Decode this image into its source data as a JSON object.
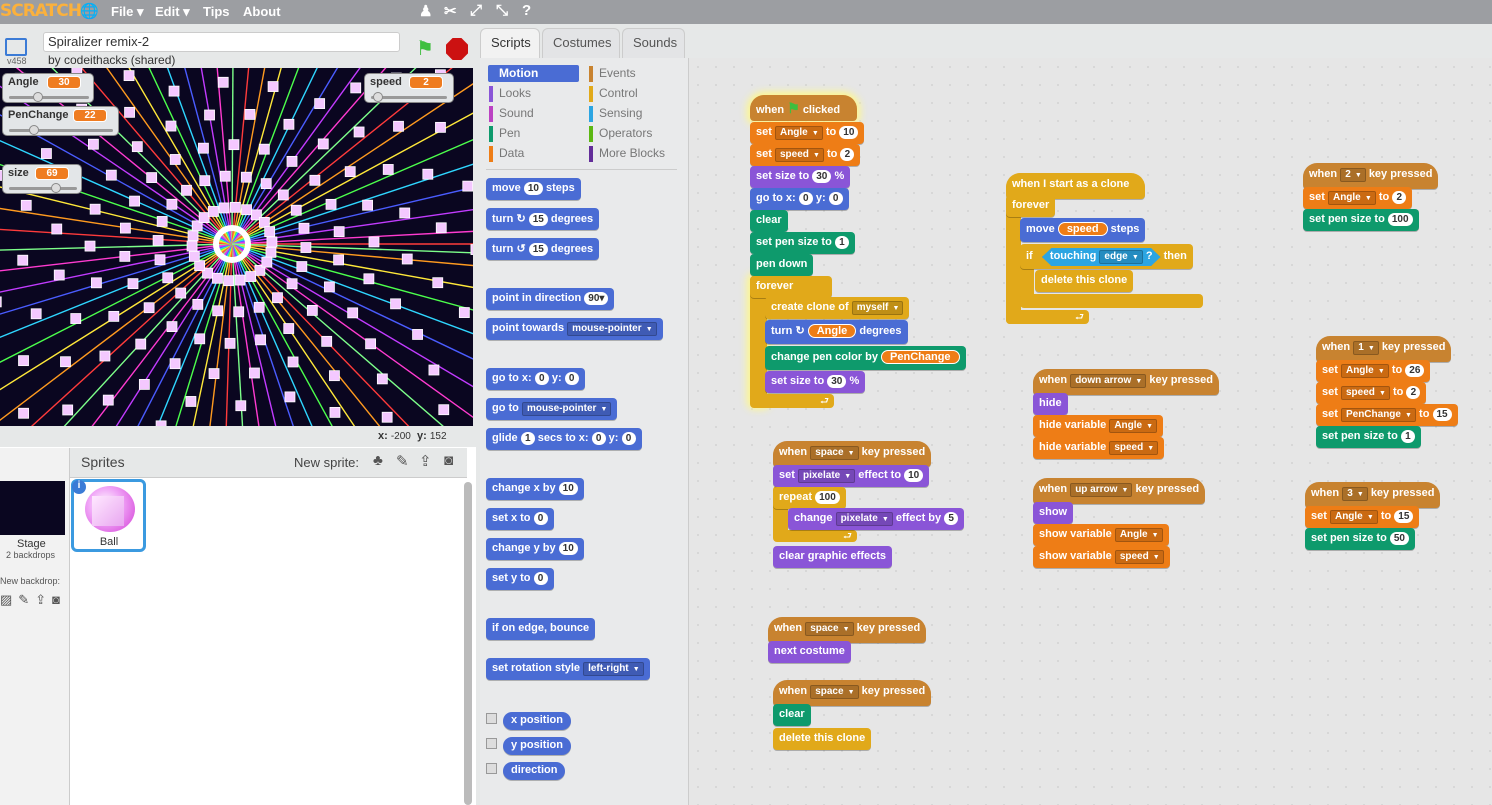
{
  "menu": {
    "logo": "SCRATCH",
    "file": "File ▾",
    "edit": "Edit ▾",
    "tips": "Tips",
    "about": "About"
  },
  "project": {
    "title": "Spiralizer remix-2",
    "by": "by codeithacks (shared)",
    "version": "v458"
  },
  "monitors": {
    "angle_label": "Angle",
    "angle": "30",
    "speed_label": "speed",
    "speed": "2",
    "penchange_label": "PenChange",
    "penchange": "22",
    "size_label": "size",
    "size": "69"
  },
  "coords": {
    "x_label": "x:",
    "x": "-200",
    "y_label": "y:",
    "y": "152"
  },
  "sprites": {
    "header": "Sprites",
    "new_sprite": "New sprite:",
    "stage_label": "Stage",
    "backdrops": "2 backdrops",
    "new_backdrop": "New backdrop:",
    "ball": "Ball"
  },
  "tabs": {
    "scripts": "Scripts",
    "costumes": "Costumes",
    "sounds": "Sounds"
  },
  "categories": {
    "motion": "Motion",
    "looks": "Looks",
    "sound": "Sound",
    "pen": "Pen",
    "data": "Data",
    "events": "Events",
    "control": "Control",
    "sensing": "Sensing",
    "operators": "Operators",
    "more": "More Blocks"
  },
  "palette": {
    "move": "move",
    "move_n": "10",
    "steps": "steps",
    "turn": "turn ↻",
    "turn_n": "15",
    "degrees": "degrees",
    "turnl": "turn ↺",
    "turnl_n": "15",
    "point_dir": "point in direction",
    "point_dir_v": "90▾",
    "point_towards": "point towards",
    "mouse": "mouse-pointer",
    "goto_xy": "go to x:",
    "zero": "0",
    "y": "y:",
    "goto": "go to",
    "glide": "glide",
    "glide_n": "1",
    "secs_to_x": "secs to x:",
    "change_x": "change x by",
    "ten": "10",
    "set_x": "set x to",
    "change_y": "change y by",
    "set_y": "set y to",
    "bounce": "if on edge, bounce",
    "rot_style": "set rotation style",
    "lr": "left-right",
    "xpos": "x position",
    "ypos": "y position",
    "direction": "direction"
  },
  "s1": {
    "when": "when",
    "clicked": "clicked",
    "set": "set",
    "angle": "Angle",
    "to": "to",
    "v10": "10",
    "speed": "speed",
    "v2": "2",
    "set_size": "set size to",
    "v30": "30",
    "pct": "%",
    "goto": "go to x:",
    "zero": "0",
    "y": "y:",
    "clear": "clear",
    "pen_size": "set pen size to",
    "one": "1",
    "pen_down": "pen down",
    "forever": "forever",
    "create_clone": "create clone of",
    "myself": "myself",
    "turn": "turn ↻",
    "degrees": "degrees",
    "change_color": "change pen color by",
    "penchange": "PenChange"
  },
  "s2": {
    "hat": "when I start as a clone",
    "forever": "forever",
    "move": "move",
    "speed": "speed",
    "steps": "steps",
    "if": "if",
    "touching": "touching",
    "edge": "edge",
    "q": "?",
    "then": "then",
    "delete": "delete this clone"
  },
  "s3": {
    "when": "when",
    "key": "space",
    "pressed": "key pressed",
    "set": "set",
    "effect": "pixelate",
    "effect_to": "effect to",
    "v10": "10",
    "repeat": "repeat",
    "v100": "100",
    "change": "change",
    "effect_by": "effect by",
    "v5": "5",
    "clear_fx": "clear graphic effects"
  },
  "s4": {
    "when": "when",
    "key": "down arrow",
    "pressed": "key pressed",
    "hide": "hide",
    "hide_var": "hide variable",
    "angle": "Angle",
    "speed": "speed"
  },
  "s5": {
    "when": "when",
    "key": "up arrow",
    "pressed": "key pressed",
    "show": "show",
    "show_var": "show variable",
    "angle": "Angle",
    "speed": "speed"
  },
  "s6": {
    "when": "when",
    "key": "space",
    "pressed": "key pressed",
    "next": "next costume"
  },
  "s7": {
    "when": "when",
    "key": "space",
    "pressed": "key pressed",
    "clear": "clear",
    "delete": "delete this clone"
  },
  "s8": {
    "when": "when",
    "key": "2",
    "pressed": "key pressed",
    "set": "set",
    "angle": "Angle",
    "to": "to",
    "v2": "2",
    "pen_size": "set pen size to",
    "v100": "100"
  },
  "s9": {
    "when": "when",
    "key": "1",
    "pressed": "key pressed",
    "set": "set",
    "angle": "Angle",
    "to": "to",
    "v26": "26",
    "speed": "speed",
    "v2": "2",
    "penchange": "PenChange",
    "v15": "15",
    "pen_size": "set pen size to",
    "one": "1"
  },
  "s10": {
    "when": "when",
    "key": "3",
    "pressed": "key pressed",
    "set": "set",
    "angle": "Angle",
    "to": "to",
    "v15": "15",
    "pen_size": "set pen size to",
    "v50": "50"
  }
}
